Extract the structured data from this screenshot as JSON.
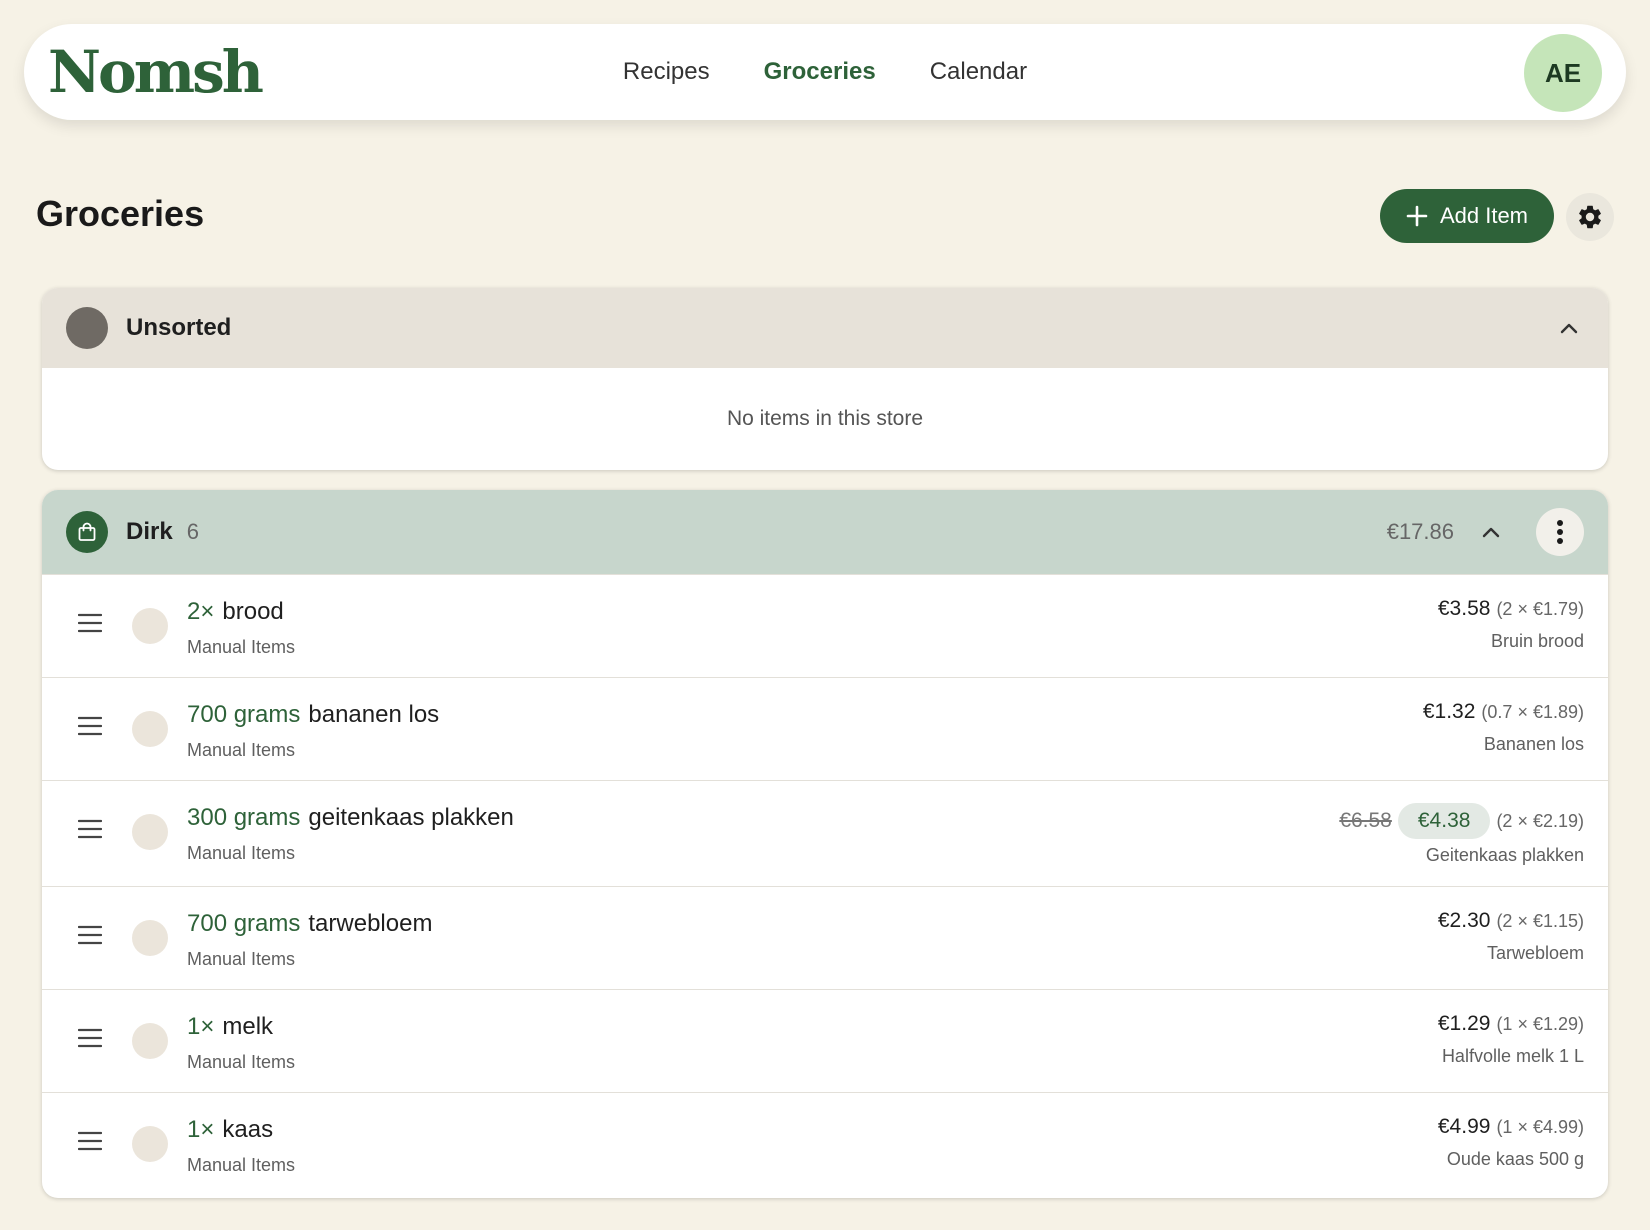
{
  "header": {
    "logo": "Nomsh",
    "nav": [
      {
        "label": "Recipes",
        "active": false
      },
      {
        "label": "Groceries",
        "active": true
      },
      {
        "label": "Calendar",
        "active": false
      }
    ],
    "avatar_initials": "AE"
  },
  "page": {
    "title": "Groceries",
    "add_item_label": "Add Item"
  },
  "stores": {
    "unsorted": {
      "name": "Unsorted",
      "empty_text": "No items in this store"
    },
    "dirk": {
      "name": "Dirk",
      "count": "6",
      "total": "€17.86",
      "items": [
        {
          "qty": "2×",
          "name": "brood",
          "source": "Manual Items",
          "price": "€3.58",
          "breakdown": "(2 × €1.79)",
          "product": "Bruin brood"
        },
        {
          "qty": "700 grams",
          "name": "bananen los",
          "source": "Manual Items",
          "price": "€1.32",
          "breakdown": "(0.7 × €1.89)",
          "product": "Bananen los"
        },
        {
          "qty": "300 grams",
          "name": "geitenkaas plakken",
          "source": "Manual Items",
          "old_price": "€6.58",
          "price": "€4.38",
          "breakdown": "(2 × €2.19)",
          "product": "Geitenkaas plakken"
        },
        {
          "qty": "700 grams",
          "name": "tarwebloem",
          "source": "Manual Items",
          "price": "€2.30",
          "breakdown": "(2 × €1.15)",
          "product": "Tarwebloem"
        },
        {
          "qty": "1×",
          "name": "melk",
          "source": "Manual Items",
          "price": "€1.29",
          "breakdown": "(1 × €1.29)",
          "product": "Halfvolle melk 1 L"
        },
        {
          "qty": "1×",
          "name": "kaas",
          "source": "Manual Items",
          "price": "€4.99",
          "breakdown": "(1 × €4.99)",
          "product": "Oude kaas 500 g"
        }
      ]
    }
  },
  "colors": {
    "brand_green": "#2e6239",
    "background": "#f6f2e6",
    "avatar_bg": "#c5e5b9",
    "dirk_header": "#c7d6cc",
    "unsorted_header": "#e7e2d9"
  }
}
